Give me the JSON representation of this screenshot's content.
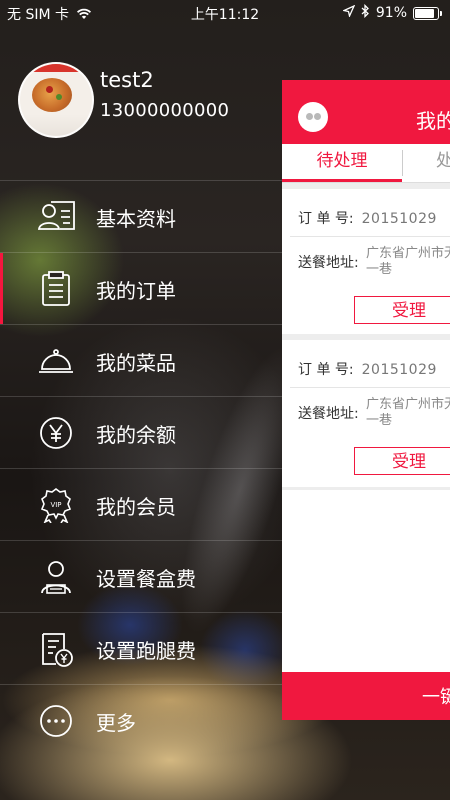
{
  "status_bar": {
    "carrier": "无 SIM 卡",
    "time": "上午11:12",
    "battery": "91%"
  },
  "profile": {
    "username": "test2",
    "phone": "13000000000"
  },
  "menu": {
    "items": [
      {
        "label": "基本资料",
        "icon": "profile-card-icon"
      },
      {
        "label": "我的订单",
        "icon": "order-clipboard-icon"
      },
      {
        "label": "我的菜品",
        "icon": "food-cloche-icon"
      },
      {
        "label": "我的余额",
        "icon": "yen-coin-icon"
      },
      {
        "label": "我的会员",
        "icon": "vip-badge-icon"
      },
      {
        "label": "设置餐盒费",
        "icon": "person-box-icon"
      },
      {
        "label": "设置跑腿费",
        "icon": "fee-document-icon"
      },
      {
        "label": "更多",
        "icon": "more-dots-icon"
      }
    ],
    "active_index": 1
  },
  "order_panel": {
    "title": "我的",
    "tabs": {
      "pending": "待处理",
      "processed": "处"
    },
    "orders": [
      {
        "order_no_label": "订 单 号:",
        "order_no": "20151029",
        "address_label": "送餐地址:",
        "address_line1": "广东省广州市无",
        "address_line2": "一巷",
        "accept_label": "受理"
      },
      {
        "order_no_label": "订 单 号:",
        "order_no": "20151029",
        "address_label": "送餐地址:",
        "address_line1": "广东省广州市无",
        "address_line2": "一巷",
        "accept_label": "受理"
      }
    ],
    "bottom_button": "一键"
  },
  "colors": {
    "accent": "#f0183f"
  }
}
